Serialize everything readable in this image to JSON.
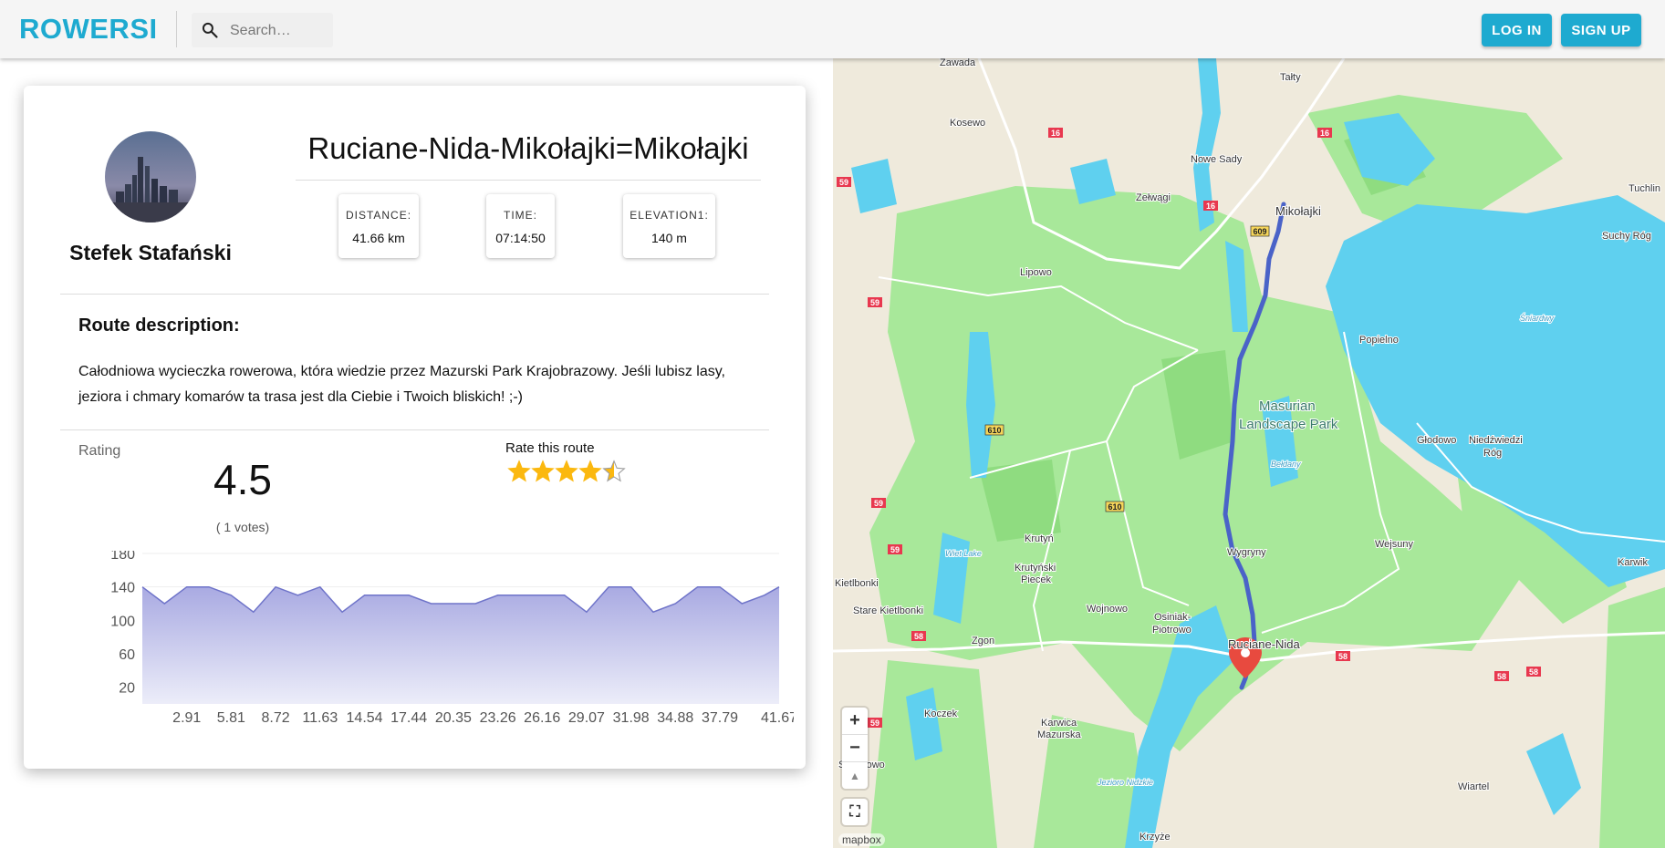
{
  "app": {
    "logo": "ROWERSI"
  },
  "search": {
    "placeholder": "Search…"
  },
  "auth": {
    "login_label": "LOG IN",
    "signup_label": "SIGN UP"
  },
  "user": {
    "name": "Stefek Stafański"
  },
  "route": {
    "title": "Ruciane-Nida-Mikołajki=Mikołajki",
    "stats": [
      {
        "label": "DISTANCE:",
        "value": "41.66 km"
      },
      {
        "label": "TIME:",
        "value": "07:14:50"
      },
      {
        "label": "ELEVATION1:",
        "value": "140 m"
      }
    ],
    "description_title": "Route description:",
    "description": "Całodniowa wycieczka rowerowa, która wiedzie przez Mazurski Park Krajobrazowy. Jeśli lubisz lasy, jeziora i chmary komarów ta trasa jest dla Ciebie i Twoich bliskich! ;-)"
  },
  "rating": {
    "label": "Rating",
    "value": "4.5",
    "votes": "( 1 votes)",
    "rate_label": "Rate this route",
    "stars": 4.5,
    "max_stars": 5,
    "star_color": "#fbb80f"
  },
  "chart_data": {
    "type": "area",
    "title": "",
    "xlabel": "",
    "ylabel": "",
    "ylim": [
      0,
      180
    ],
    "y_ticks": [
      "180",
      "140",
      "100",
      "60",
      "20"
    ],
    "x_ticks": [
      "2.91",
      "5.81",
      "8.72",
      "11.63",
      "14.54",
      "17.44",
      "20.35",
      "23.26",
      "26.16",
      "29.07",
      "31.98",
      "34.88",
      "37.79",
      "41.67"
    ],
    "x": [
      0,
      1.45,
      2.91,
      4.36,
      5.81,
      7.27,
      8.72,
      10.17,
      11.63,
      13.08,
      14.54,
      15.99,
      17.44,
      18.9,
      20.35,
      21.8,
      23.26,
      24.71,
      26.16,
      27.62,
      29.07,
      30.52,
      31.98,
      33.43,
      34.88,
      36.34,
      37.79,
      39.24,
      40.7,
      41.67
    ],
    "values": [
      140,
      120,
      140,
      140,
      130,
      110,
      140,
      130,
      140,
      110,
      130,
      130,
      130,
      120,
      120,
      120,
      130,
      130,
      130,
      130,
      110,
      140,
      140,
      110,
      120,
      140,
      140,
      120,
      130,
      140
    ],
    "grid": true,
    "line_color": "#6f74c9",
    "fill_top": "#a9aae2",
    "fill_bottom": "#ecedf9"
  },
  "map": {
    "attribution": "mapbox",
    "zoom_in": "+",
    "zoom_out": "−",
    "compass": "▲",
    "fullscreen": "⛶",
    "route_color": "#4a63c8",
    "marker_color": "#e84a3f",
    "labels": {
      "zawada": "Zawada",
      "tatty": "Tałty",
      "kosewo": "Kosewo",
      "nowe_sady": "Nowe Sady",
      "zelwagi": "Zełwągi",
      "mikolajki": "Mikołajki",
      "tuchlin": "Tuchlin",
      "suchy_rog": "Suchy Róg",
      "lipowo": "Lipowo",
      "popielno": "Popielno",
      "sniardwy": "Śniardwy",
      "masurian": "Masurian",
      "landscape_park": "Landscape Park",
      "glodowo": "Głodowo",
      "niedzwiedzi": "Niedźwiedzi",
      "rog": "Róg",
      "beldany": "Bełdany",
      "wiet_lake": "Wiet Lake",
      "krutyn": "Krutyń",
      "krutynski": "Krutyński",
      "piecek": "Piecek",
      "wygryny": "Wygryny",
      "wejsuny": "Wejsuny",
      "karwik": "Karwik",
      "kietlbonki": "Kietlbonki",
      "stare_kietlbonki": "Stare Kietlbonki",
      "wojnowo": "Wojnowo",
      "osiniak": "Osiniak-",
      "piotrowo": "Piotrowo",
      "ruciane": "Ruciane-Nida",
      "zgon": "Zgon",
      "koczek": "Koczek",
      "karwica": "Karwica",
      "mazurska": "Mazurska",
      "spychowo": "Spychowo",
      "jezioro_nidzkie": "Jezioro Nidzkie",
      "wiartel": "Wiartel",
      "krzyze": "Krzyże"
    },
    "road_shields": [
      "16",
      "16",
      "16",
      "59",
      "59",
      "59",
      "59",
      "609",
      "610",
      "610",
      "58",
      "58",
      "58",
      "58",
      "59"
    ]
  }
}
